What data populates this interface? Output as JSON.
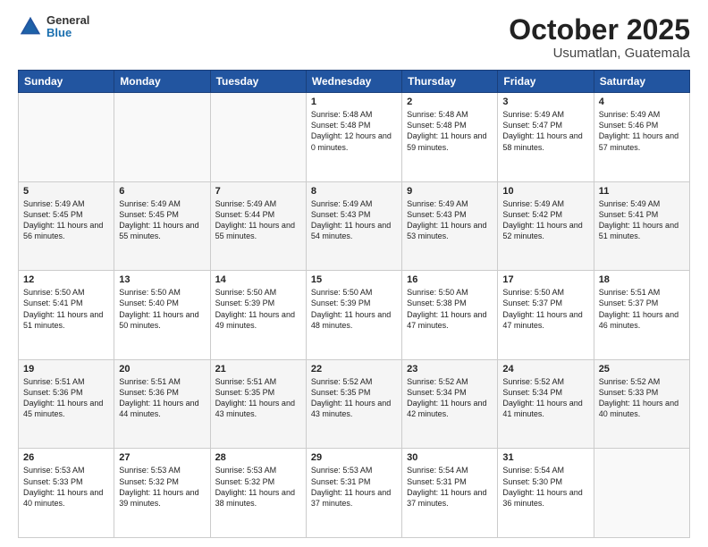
{
  "header": {
    "logo": {
      "general": "General",
      "blue": "Blue"
    },
    "title": "October 2025",
    "location": "Usumatlan, Guatemala"
  },
  "weekdays": [
    "Sunday",
    "Monday",
    "Tuesday",
    "Wednesday",
    "Thursday",
    "Friday",
    "Saturday"
  ],
  "weeks": [
    [
      {
        "day": "",
        "sunrise": "",
        "sunset": "",
        "daylight": "",
        "empty": true
      },
      {
        "day": "",
        "sunrise": "",
        "sunset": "",
        "daylight": "",
        "empty": true
      },
      {
        "day": "",
        "sunrise": "",
        "sunset": "",
        "daylight": "",
        "empty": true
      },
      {
        "day": "1",
        "sunrise": "Sunrise: 5:48 AM",
        "sunset": "Sunset: 5:48 PM",
        "daylight": "Daylight: 12 hours and 0 minutes."
      },
      {
        "day": "2",
        "sunrise": "Sunrise: 5:48 AM",
        "sunset": "Sunset: 5:48 PM",
        "daylight": "Daylight: 11 hours and 59 minutes."
      },
      {
        "day": "3",
        "sunrise": "Sunrise: 5:49 AM",
        "sunset": "Sunset: 5:47 PM",
        "daylight": "Daylight: 11 hours and 58 minutes."
      },
      {
        "day": "4",
        "sunrise": "Sunrise: 5:49 AM",
        "sunset": "Sunset: 5:46 PM",
        "daylight": "Daylight: 11 hours and 57 minutes."
      }
    ],
    [
      {
        "day": "5",
        "sunrise": "Sunrise: 5:49 AM",
        "sunset": "Sunset: 5:45 PM",
        "daylight": "Daylight: 11 hours and 56 minutes."
      },
      {
        "day": "6",
        "sunrise": "Sunrise: 5:49 AM",
        "sunset": "Sunset: 5:45 PM",
        "daylight": "Daylight: 11 hours and 55 minutes."
      },
      {
        "day": "7",
        "sunrise": "Sunrise: 5:49 AM",
        "sunset": "Sunset: 5:44 PM",
        "daylight": "Daylight: 11 hours and 55 minutes."
      },
      {
        "day": "8",
        "sunrise": "Sunrise: 5:49 AM",
        "sunset": "Sunset: 5:43 PM",
        "daylight": "Daylight: 11 hours and 54 minutes."
      },
      {
        "day": "9",
        "sunrise": "Sunrise: 5:49 AM",
        "sunset": "Sunset: 5:43 PM",
        "daylight": "Daylight: 11 hours and 53 minutes."
      },
      {
        "day": "10",
        "sunrise": "Sunrise: 5:49 AM",
        "sunset": "Sunset: 5:42 PM",
        "daylight": "Daylight: 11 hours and 52 minutes."
      },
      {
        "day": "11",
        "sunrise": "Sunrise: 5:49 AM",
        "sunset": "Sunset: 5:41 PM",
        "daylight": "Daylight: 11 hours and 51 minutes."
      }
    ],
    [
      {
        "day": "12",
        "sunrise": "Sunrise: 5:50 AM",
        "sunset": "Sunset: 5:41 PM",
        "daylight": "Daylight: 11 hours and 51 minutes."
      },
      {
        "day": "13",
        "sunrise": "Sunrise: 5:50 AM",
        "sunset": "Sunset: 5:40 PM",
        "daylight": "Daylight: 11 hours and 50 minutes."
      },
      {
        "day": "14",
        "sunrise": "Sunrise: 5:50 AM",
        "sunset": "Sunset: 5:39 PM",
        "daylight": "Daylight: 11 hours and 49 minutes."
      },
      {
        "day": "15",
        "sunrise": "Sunrise: 5:50 AM",
        "sunset": "Sunset: 5:39 PM",
        "daylight": "Daylight: 11 hours and 48 minutes."
      },
      {
        "day": "16",
        "sunrise": "Sunrise: 5:50 AM",
        "sunset": "Sunset: 5:38 PM",
        "daylight": "Daylight: 11 hours and 47 minutes."
      },
      {
        "day": "17",
        "sunrise": "Sunrise: 5:50 AM",
        "sunset": "Sunset: 5:37 PM",
        "daylight": "Daylight: 11 hours and 47 minutes."
      },
      {
        "day": "18",
        "sunrise": "Sunrise: 5:51 AM",
        "sunset": "Sunset: 5:37 PM",
        "daylight": "Daylight: 11 hours and 46 minutes."
      }
    ],
    [
      {
        "day": "19",
        "sunrise": "Sunrise: 5:51 AM",
        "sunset": "Sunset: 5:36 PM",
        "daylight": "Daylight: 11 hours and 45 minutes."
      },
      {
        "day": "20",
        "sunrise": "Sunrise: 5:51 AM",
        "sunset": "Sunset: 5:36 PM",
        "daylight": "Daylight: 11 hours and 44 minutes."
      },
      {
        "day": "21",
        "sunrise": "Sunrise: 5:51 AM",
        "sunset": "Sunset: 5:35 PM",
        "daylight": "Daylight: 11 hours and 43 minutes."
      },
      {
        "day": "22",
        "sunrise": "Sunrise: 5:52 AM",
        "sunset": "Sunset: 5:35 PM",
        "daylight": "Daylight: 11 hours and 43 minutes."
      },
      {
        "day": "23",
        "sunrise": "Sunrise: 5:52 AM",
        "sunset": "Sunset: 5:34 PM",
        "daylight": "Daylight: 11 hours and 42 minutes."
      },
      {
        "day": "24",
        "sunrise": "Sunrise: 5:52 AM",
        "sunset": "Sunset: 5:34 PM",
        "daylight": "Daylight: 11 hours and 41 minutes."
      },
      {
        "day": "25",
        "sunrise": "Sunrise: 5:52 AM",
        "sunset": "Sunset: 5:33 PM",
        "daylight": "Daylight: 11 hours and 40 minutes."
      }
    ],
    [
      {
        "day": "26",
        "sunrise": "Sunrise: 5:53 AM",
        "sunset": "Sunset: 5:33 PM",
        "daylight": "Daylight: 11 hours and 40 minutes."
      },
      {
        "day": "27",
        "sunrise": "Sunrise: 5:53 AM",
        "sunset": "Sunset: 5:32 PM",
        "daylight": "Daylight: 11 hours and 39 minutes."
      },
      {
        "day": "28",
        "sunrise": "Sunrise: 5:53 AM",
        "sunset": "Sunset: 5:32 PM",
        "daylight": "Daylight: 11 hours and 38 minutes."
      },
      {
        "day": "29",
        "sunrise": "Sunrise: 5:53 AM",
        "sunset": "Sunset: 5:31 PM",
        "daylight": "Daylight: 11 hours and 37 minutes."
      },
      {
        "day": "30",
        "sunrise": "Sunrise: 5:54 AM",
        "sunset": "Sunset: 5:31 PM",
        "daylight": "Daylight: 11 hours and 37 minutes."
      },
      {
        "day": "31",
        "sunrise": "Sunrise: 5:54 AM",
        "sunset": "Sunset: 5:30 PM",
        "daylight": "Daylight: 11 hours and 36 minutes."
      },
      {
        "day": "",
        "sunrise": "",
        "sunset": "",
        "daylight": "",
        "empty": true
      }
    ]
  ]
}
